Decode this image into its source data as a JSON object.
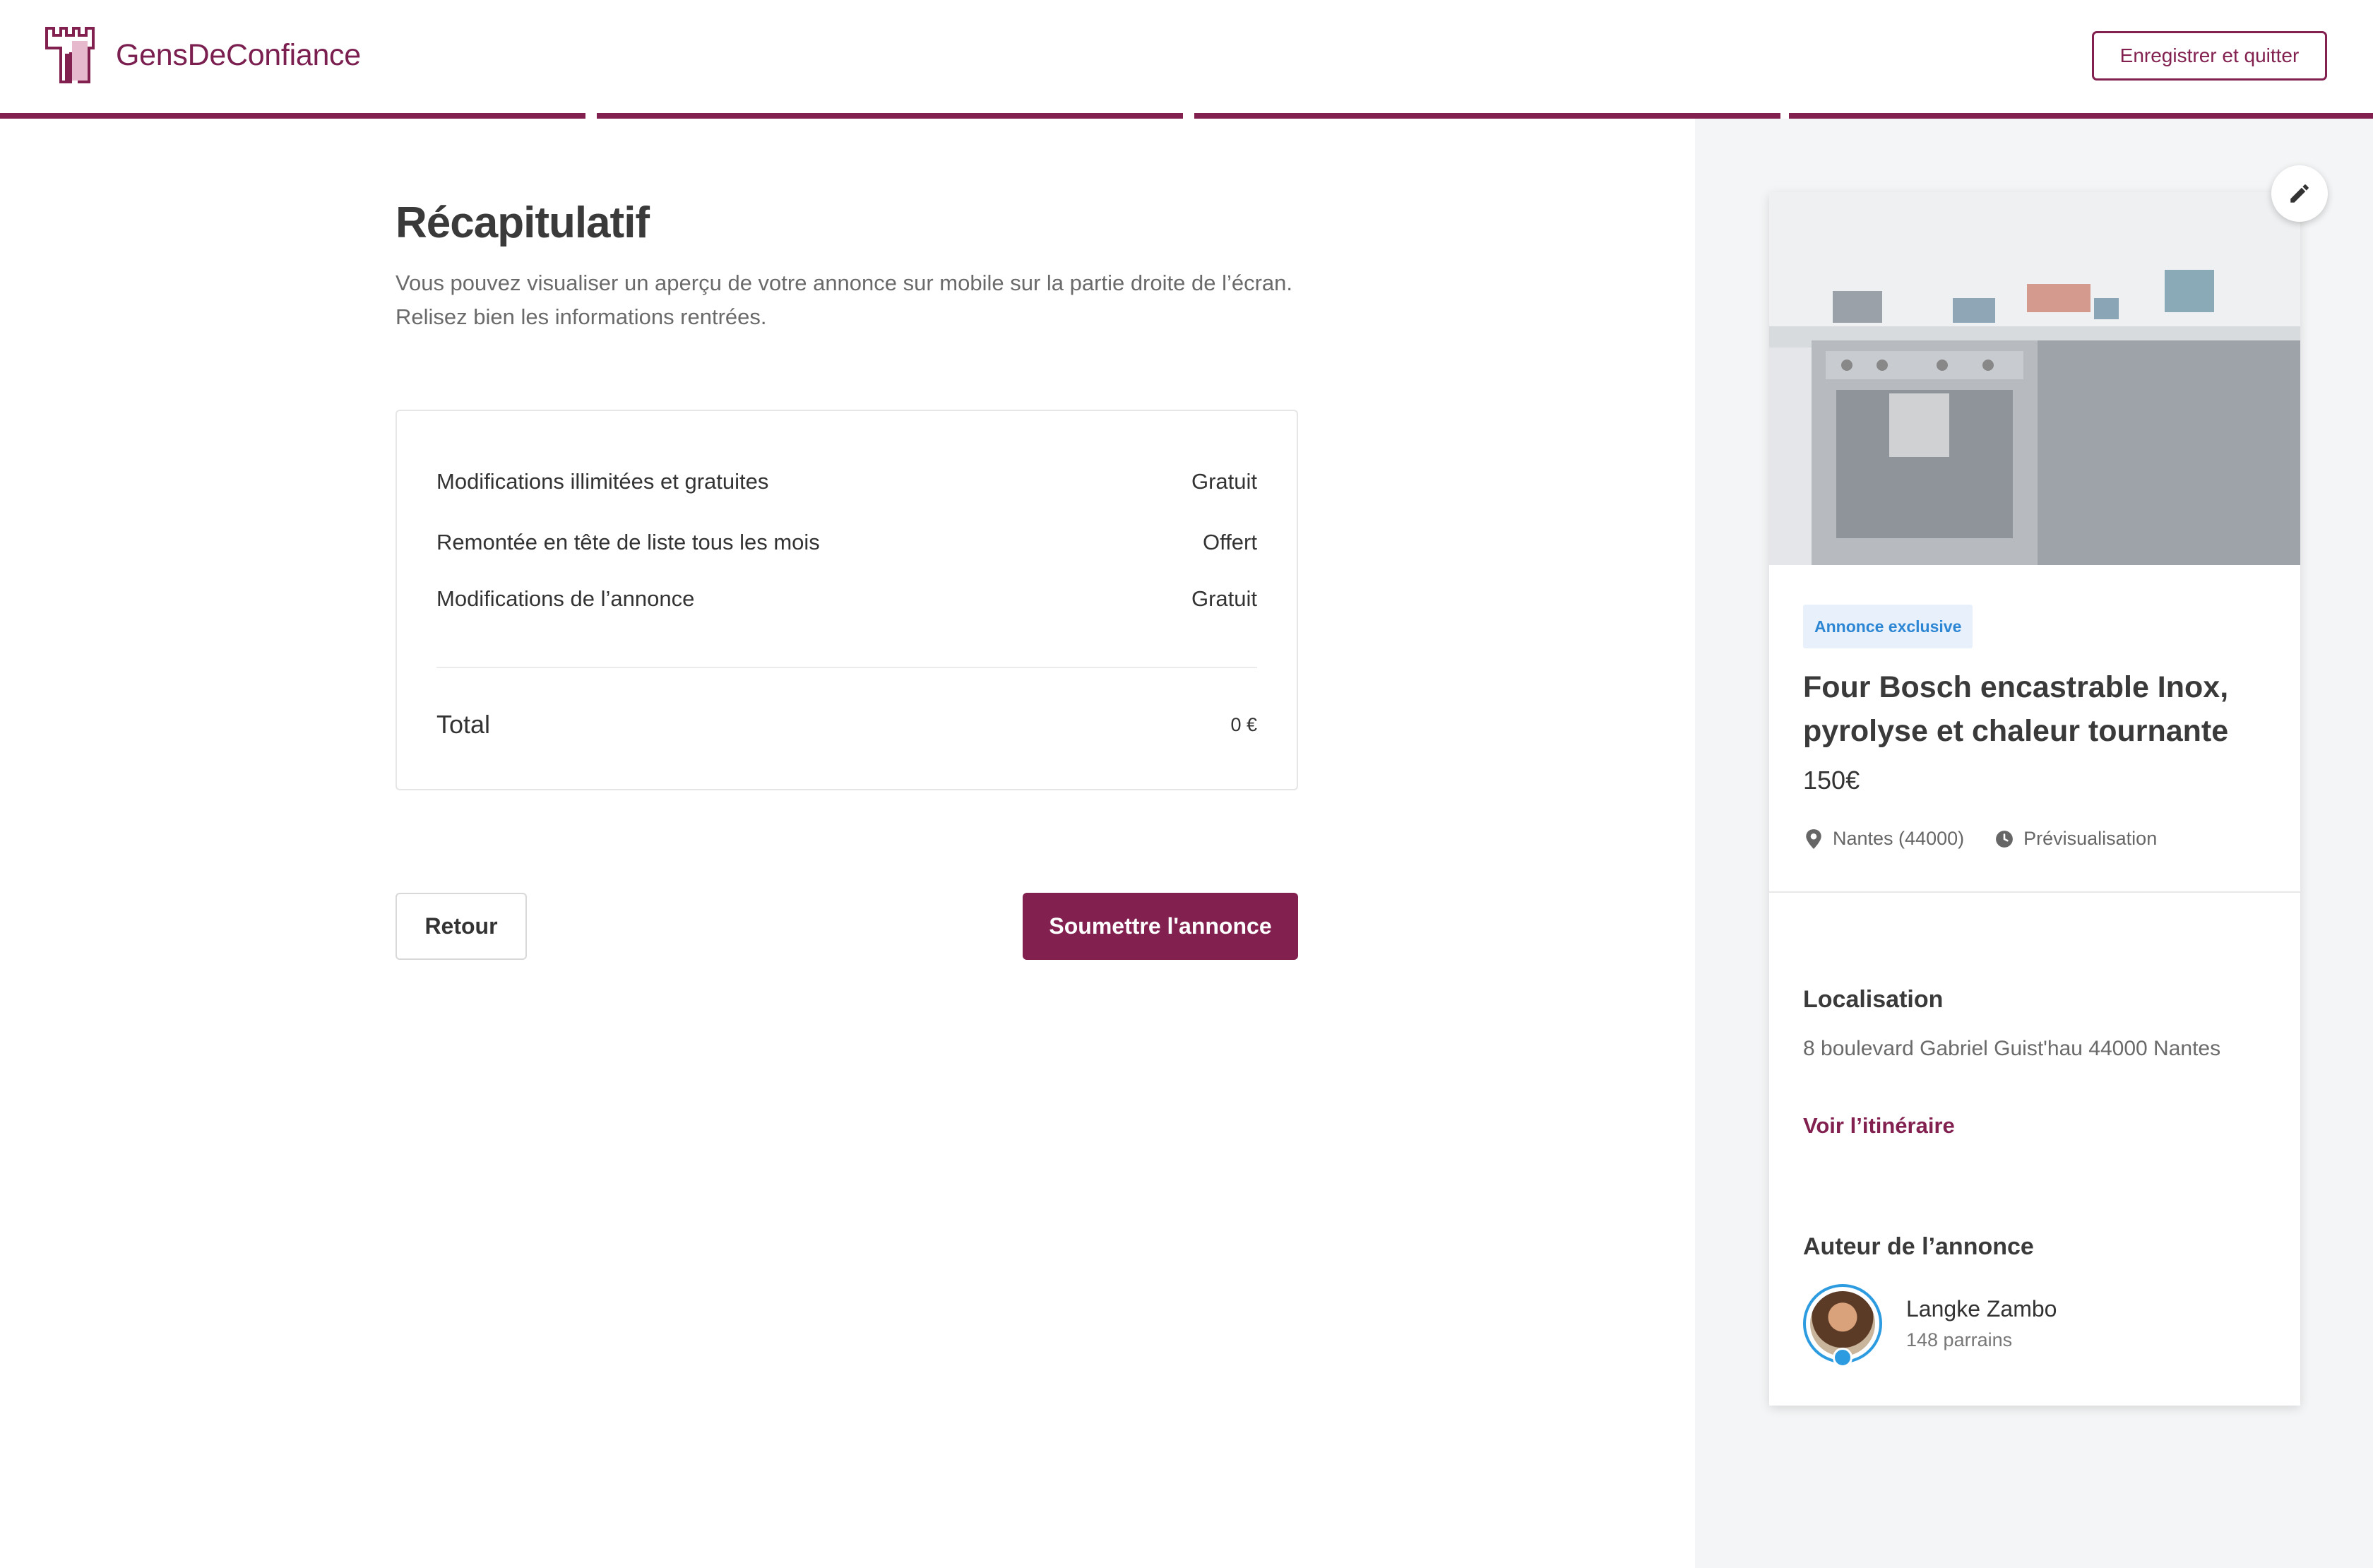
{
  "header": {
    "brand": "GensDeConfiance",
    "save_quit_label": "Enregistrer et quitter",
    "brand_color": "#82204f",
    "progress_steps": 4,
    "progress_completed": 4
  },
  "main": {
    "title": "Récapitulatif",
    "subtitle": "Vous pouvez visualiser un aperçu de votre annonce sur mobile sur la partie droite de l’écran. Relisez bien les informations rentrées.",
    "summary": {
      "rows": [
        {
          "label": "Modifications illimitées et gratuites",
          "value": "Gratuit"
        },
        {
          "label": "Remontée en tête de liste tous les mois",
          "value": "Offert"
        },
        {
          "label": "Modifications de l’annonce",
          "value": "Gratuit"
        }
      ],
      "total_label": "Total",
      "total_value": "0 €"
    },
    "back_label": "Retour",
    "submit_label": "Soumettre l'annonce"
  },
  "preview": {
    "badge": "Annonce exclusive",
    "title": "Four Bosch encastrable Inox, pyrolyse et chaleur tournante",
    "price": "150€",
    "location_meta": "Nantes (44000)",
    "time_meta": "Prévisualisation",
    "localisation_title": "Localisation",
    "address": "8 boulevard Gabriel Guist'hau 44000 Nantes",
    "route_link": "Voir l’itinéraire",
    "author_title": "Auteur de l’annonce",
    "author_name": "Langke Zambo",
    "author_sub": "148 parrains",
    "icons": {
      "edit": "pencil-icon",
      "location": "map-pin-icon",
      "time": "clock-icon",
      "verified": "verified-badge-icon"
    }
  }
}
